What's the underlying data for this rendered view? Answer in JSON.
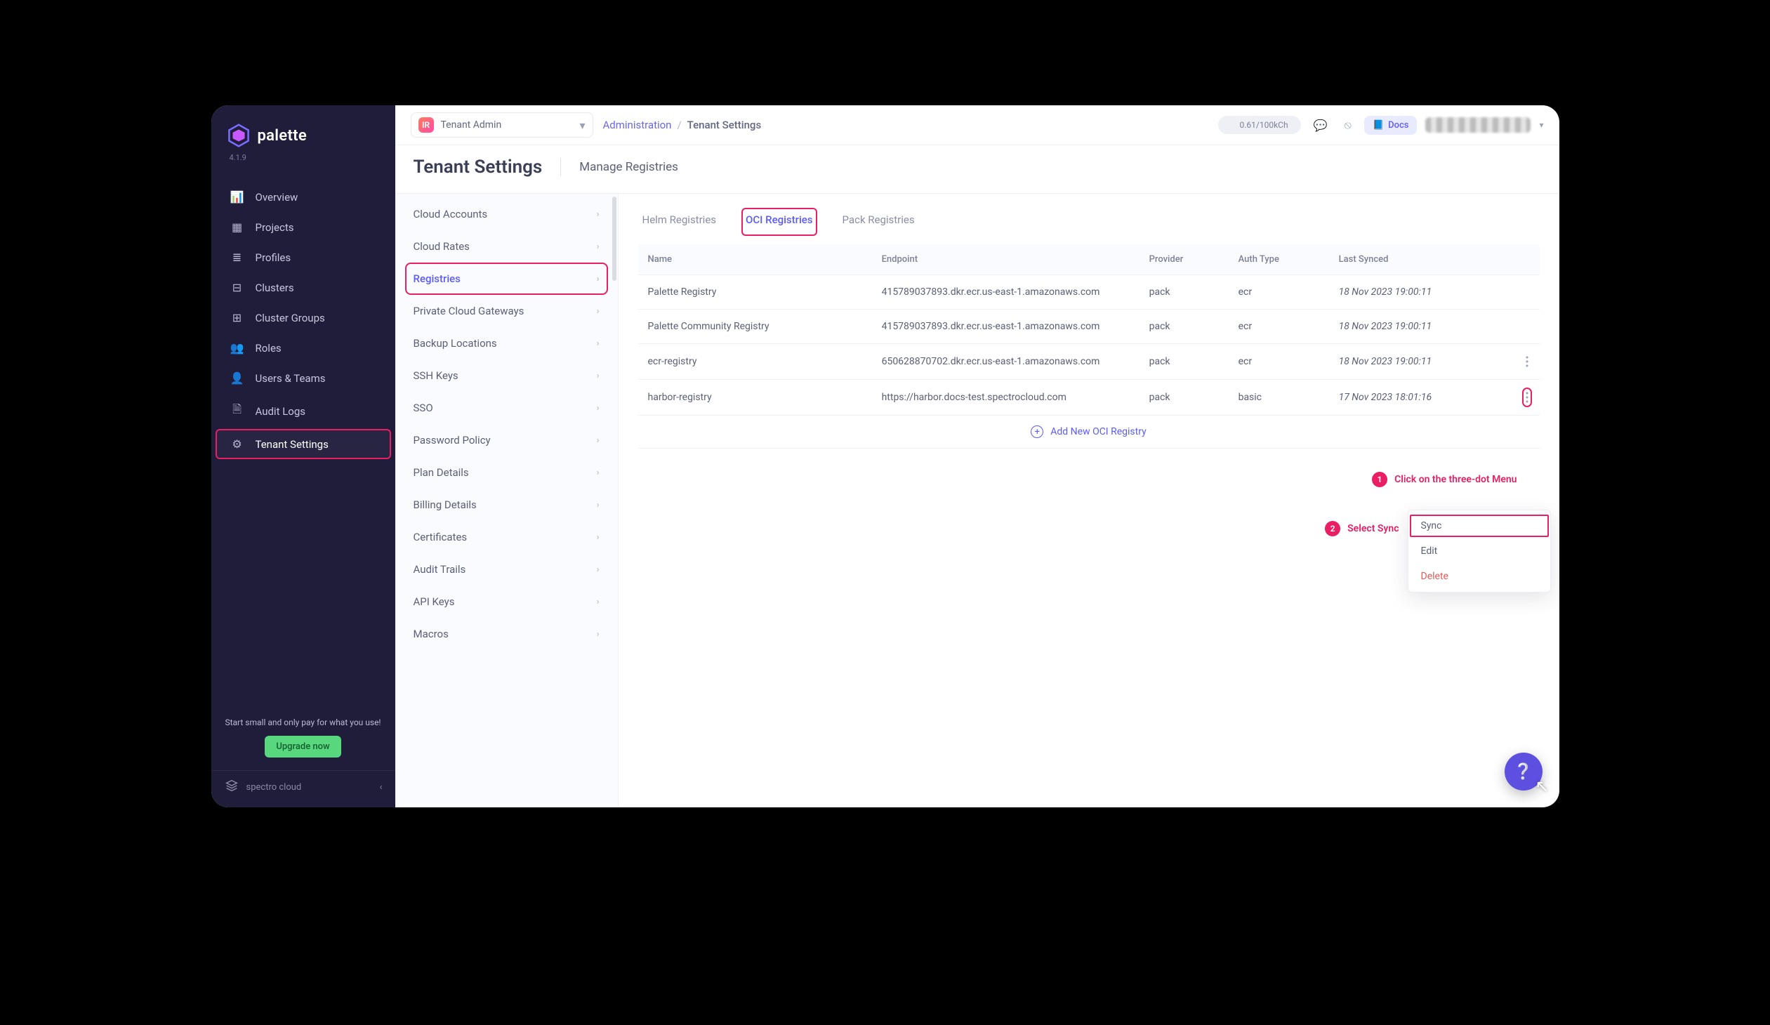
{
  "brand": {
    "name": "palette",
    "version": "4.1.9"
  },
  "sidebar": {
    "items": [
      {
        "label": "Overview",
        "icon": "📊"
      },
      {
        "label": "Projects",
        "icon": "▦"
      },
      {
        "label": "Profiles",
        "icon": "≣"
      },
      {
        "label": "Clusters",
        "icon": "⊟"
      },
      {
        "label": "Cluster Groups",
        "icon": "⊞"
      },
      {
        "label": "Roles",
        "icon": "👥"
      },
      {
        "label": "Users & Teams",
        "icon": "👤"
      },
      {
        "label": "Audit Logs",
        "icon": "🗎"
      },
      {
        "label": "Tenant Settings",
        "icon": "⚙"
      }
    ],
    "upgrade_text": "Start small and only pay for what you use!",
    "upgrade_btn": "Upgrade now",
    "footer_brand": "spectro cloud"
  },
  "topbar": {
    "scope": "Tenant Admin",
    "breadcrumb": [
      "Administration",
      "Tenant Settings"
    ],
    "credits": "0.61/100kCh",
    "docs_label": "Docs"
  },
  "page": {
    "h1": "Tenant Settings",
    "subtitle": "Manage Registries"
  },
  "settings_menu": [
    "Cloud Accounts",
    "Cloud Rates",
    "Registries",
    "Private Cloud Gateways",
    "Backup Locations",
    "SSH Keys",
    "SSO",
    "Password Policy",
    "Plan Details",
    "Billing Details",
    "Certificates",
    "Audit Trails",
    "API Keys",
    "Macros"
  ],
  "settings_active_index": 2,
  "tabs": [
    "Helm Registries",
    "OCI Registries",
    "Pack Registries"
  ],
  "tab_active_index": 1,
  "table": {
    "columns": [
      "Name",
      "Endpoint",
      "Provider",
      "Auth Type",
      "Last Synced"
    ],
    "rows": [
      {
        "name": "Palette Registry",
        "endpoint": "415789037893.dkr.ecr.us-east-1.amazonaws.com",
        "provider": "pack",
        "auth": "ecr",
        "last": "18 Nov 2023 19:00:11"
      },
      {
        "name": "Palette Community Registry",
        "endpoint": "415789037893.dkr.ecr.us-east-1.amazonaws.com",
        "provider": "pack",
        "auth": "ecr",
        "last": "18 Nov 2023 19:00:11"
      },
      {
        "name": "ecr-registry",
        "endpoint": "650628870702.dkr.ecr.us-east-1.amazonaws.com",
        "provider": "pack",
        "auth": "ecr",
        "last": "18 Nov 2023 19:00:11"
      },
      {
        "name": "harbor-registry",
        "endpoint": "https://harbor.docs-test.spectrocloud.com",
        "provider": "pack",
        "auth": "basic",
        "last": "17 Nov 2023 18:01:16"
      }
    ],
    "add_label": "Add New OCI Registry"
  },
  "annotations": {
    "one": "Click on the three-dot Menu",
    "two": "Select Sync"
  },
  "dropdown": {
    "items": [
      "Sync",
      "Edit",
      "Delete"
    ],
    "highlighted_index": 0,
    "danger_index": 2
  }
}
